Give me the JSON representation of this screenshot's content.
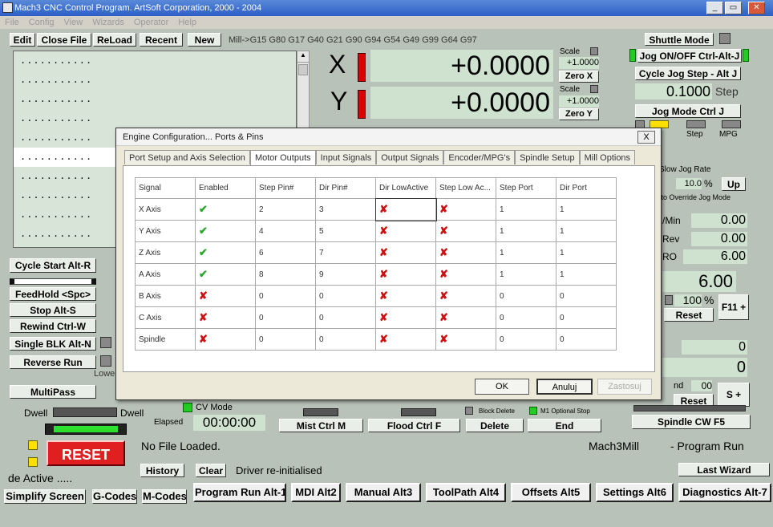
{
  "window": {
    "title": "Mach3 CNC Control Program. ArtSoft Corporation, 2000 - 2004"
  },
  "menu": [
    "File",
    "Config",
    "View",
    "Wizards",
    "Operator",
    "Help"
  ],
  "file_buttons": [
    "Edit",
    "Close File",
    "ReLoad",
    "Recent",
    "New"
  ],
  "modal_line": "Mill->G15  G80 G17 G40 G21 G90 G94 G54 G49 G99 G64 G97",
  "gcode_lines": [
    "...........",
    "...........",
    "...........",
    "...........",
    "...........",
    "...........",
    "...........",
    "...........",
    "...........",
    "..........."
  ],
  "axes": [
    {
      "name": "X",
      "value": "+0.0000",
      "scale_label": "Scale",
      "scale": "+1.0000",
      "zero": "Zero X"
    },
    {
      "name": "Y",
      "value": "+0.0000",
      "scale_label": "Scale",
      "scale": "+1.0000",
      "zero": "Zero Y"
    }
  ],
  "jog": {
    "shuttle": "Shuttle Mode",
    "jog_onoff": "Jog ON/OFF Ctrl-Alt-J",
    "cycle_jog": "Cycle Jog Step - Alt J",
    "step_value": "0.1000",
    "step_label": "Step",
    "jog_mode": "Jog Mode Ctrl J",
    "step_tab": "Step",
    "mpg_tab": "MPG",
    "slow_jog": "Slow Jog Rate",
    "slow_jog_value": "10.0",
    "percent": "%",
    "up": "Up",
    "override_note": "g to Override Jog Mode"
  },
  "feed": {
    "min_label": "/Min",
    "min_value": "0.00",
    "rev_label": "Rev",
    "rev_value": "0.00",
    "fro_label": "RO",
    "fro_value": "6.00",
    "big_value": "6.00",
    "pct": "100",
    "pct_sign": "%",
    "reset": "Reset",
    "f11": "F11 +"
  },
  "spindle": {
    "val1": "0",
    "val2": "0",
    "sro_label": "nd",
    "sro_value": "00",
    "reset": "Reset",
    "s_plus": "S +",
    "cw": "Spindle CW F5"
  },
  "left_controls": {
    "cycle_start": "Cycle Start Alt-R",
    "feedhold": "FeedHold <Spc>",
    "stop": "Stop Alt-S",
    "rewind": "Rewind Ctrl-W",
    "single_blk": "Single BLK Alt-N",
    "reverse_run": "Reverse Run",
    "lower_label": "Lowe",
    "multipass": "MultiPass",
    "dwell1": "Dwell",
    "dwell2": "Dwell",
    "cv_mode": "CV Mode",
    "elapsed_label": "Elapsed",
    "elapsed": "00:00:00",
    "reset": "RESET"
  },
  "bottom": {
    "mist": "Mist Ctrl M",
    "flood": "Flood Ctrl F",
    "delete": "Delete",
    "end": "End",
    "block_delete": "Block Delete",
    "m1_optional": "M1 Optional Stop",
    "file_status": "No File Loaded.",
    "profile": "Mach3Mill",
    "mode": "- Program Run",
    "history": "History",
    "clear": "Clear",
    "status_msg": "Driver re-initialised",
    "last_wizard": "Last Wizard",
    "active": "de Active ....."
  },
  "screen_tabs": [
    "Simplify Screen",
    "G-Codes",
    "M-Codes",
    "Program Run Alt-1",
    "MDI Alt2",
    "Manual Alt3",
    "ToolPath Alt4",
    "Offsets Alt5",
    "Settings Alt6",
    "Diagnostics Alt-7"
  ],
  "dialog": {
    "title": "Engine Configuration... Ports & Pins",
    "close": "X",
    "tabs": [
      "Port Setup and Axis Selection",
      "Motor Outputs",
      "Input Signals",
      "Output Signals",
      "Encoder/MPG's",
      "Spindle Setup",
      "Mill Options"
    ],
    "active_tab": 1,
    "columns": [
      "Signal",
      "Enabled",
      "Step Pin#",
      "Dir Pin#",
      "Dir LowActive",
      "Step Low Ac...",
      "Step Port",
      "Dir Port"
    ],
    "rows": [
      {
        "signal": "X Axis",
        "enabled": true,
        "step_pin": "2",
        "dir_pin": "3",
        "dir_low": false,
        "step_low": false,
        "step_port": "1",
        "dir_port": "1"
      },
      {
        "signal": "Y Axis",
        "enabled": true,
        "step_pin": "4",
        "dir_pin": "5",
        "dir_low": false,
        "step_low": false,
        "step_port": "1",
        "dir_port": "1"
      },
      {
        "signal": "Z Axis",
        "enabled": true,
        "step_pin": "6",
        "dir_pin": "7",
        "dir_low": false,
        "step_low": false,
        "step_port": "1",
        "dir_port": "1"
      },
      {
        "signal": "A Axis",
        "enabled": true,
        "step_pin": "8",
        "dir_pin": "9",
        "dir_low": false,
        "step_low": false,
        "step_port": "1",
        "dir_port": "1"
      },
      {
        "signal": "B Axis",
        "enabled": false,
        "step_pin": "0",
        "dir_pin": "0",
        "dir_low": false,
        "step_low": false,
        "step_port": "0",
        "dir_port": "0"
      },
      {
        "signal": "C Axis",
        "enabled": false,
        "step_pin": "0",
        "dir_pin": "0",
        "dir_low": false,
        "step_low": false,
        "step_port": "0",
        "dir_port": "0"
      },
      {
        "signal": "Spindle",
        "enabled": false,
        "step_pin": "0",
        "dir_pin": "0",
        "dir_low": false,
        "step_low": false,
        "step_port": "0",
        "dir_port": "0"
      }
    ],
    "ok": "OK",
    "cancel": "Anuluj",
    "apply": "Zastosuj"
  }
}
